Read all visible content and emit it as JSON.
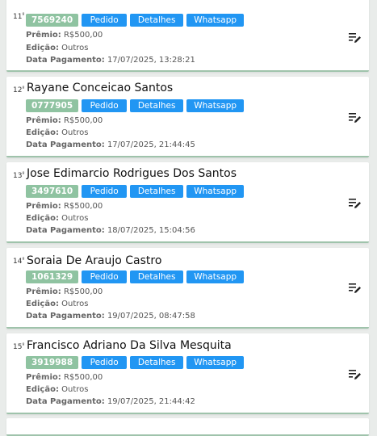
{
  "labels": {
    "premio": "Prêmio:",
    "edicao": "Edição:",
    "data_pagamento": "Data Pagamento:",
    "pedido": "Pedido",
    "detalhes": "Detalhes",
    "whatsapp": "Whatsapp"
  },
  "icons": {
    "edit": "edit-list-icon"
  },
  "colors": {
    "code_badge": "#8fc3a1",
    "button": "#2196f3",
    "card_border": "#9fc3ab"
  },
  "cards": [
    {
      "rank": "11",
      "rank_sup": "º",
      "name": "",
      "code": "7569240",
      "premio": "R$500,00",
      "edicao": "Outros",
      "data_pagamento": "17/07/2025, 13:28:21"
    },
    {
      "rank": "12",
      "rank_sup": "º",
      "name": "Rayane Conceicao Santos",
      "code": "0777905",
      "premio": "R$500,00",
      "edicao": "Outros",
      "data_pagamento": "17/07/2025, 21:44:45"
    },
    {
      "rank": "13",
      "rank_sup": "º",
      "name": "Jose Edimarcio Rodrigues Dos Santos",
      "code": "3497610",
      "premio": "R$500,00",
      "edicao": "Outros",
      "data_pagamento": "18/07/2025, 15:04:56"
    },
    {
      "rank": "14",
      "rank_sup": "º",
      "name": "Soraia De Araujo Castro",
      "code": "1061329",
      "premio": "R$500,00",
      "edicao": "Outros",
      "data_pagamento": "19/07/2025, 08:47:58"
    },
    {
      "rank": "15",
      "rank_sup": "º",
      "name": "Francisco Adriano Da Silva Mesquita",
      "code": "3919988",
      "premio": "R$500,00",
      "edicao": "Outros",
      "data_pagamento": "19/07/2025, 21:44:42"
    }
  ]
}
